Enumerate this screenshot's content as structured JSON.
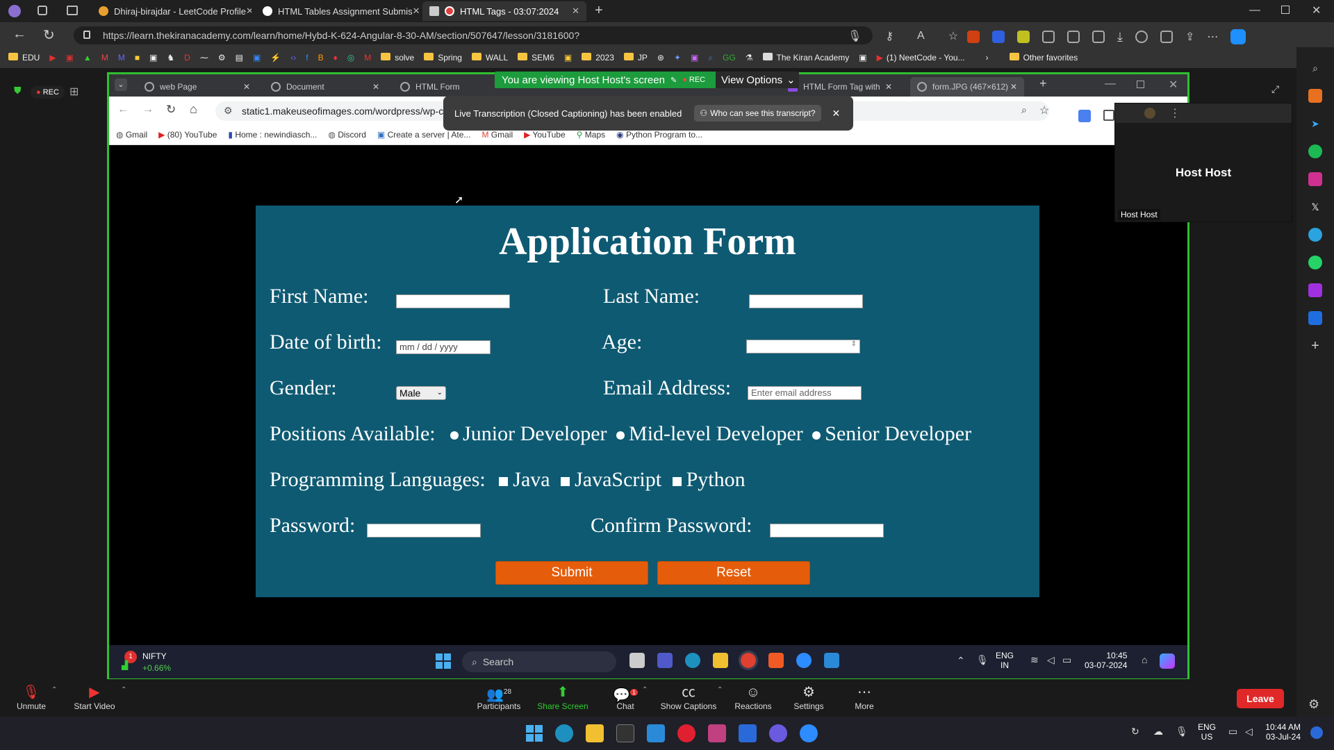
{
  "outer_browser": {
    "tabs": [
      {
        "title": "Dhiraj-birajdar - LeetCode Profile"
      },
      {
        "title": "HTML Tables Assignment Submis"
      },
      {
        "title": "HTML Tags - 03:07:2024",
        "active": true
      }
    ],
    "url": "https://learn.thekiranacademy.com/learn/home/Hybd-K-624-Angular-8-30-AM/section/507647/lesson/3181600?",
    "bookmarks": [
      "EDU",
      "solve",
      "Spring",
      "WALL",
      "SEM6",
      "2023",
      "JP",
      "The Kiran Academy",
      "(1) NeetCode - You...",
      "Other favorites"
    ]
  },
  "zoom": {
    "rec_label": "REC",
    "viewing_banner": "You are viewing Host Host's screen",
    "banner_rec": "REC",
    "view_options": "View Options",
    "transcription_msg": "Live Transcription (Closed Captioning) has been enabled",
    "who_can_see": "Who can see this transcript?",
    "host_name_big": "Host Host",
    "host_name_small": "Host Host",
    "controls": {
      "unmute": "Unmute",
      "start_video": "Start Video",
      "participants": "Participants",
      "participants_count": "28",
      "share_screen": "Share Screen",
      "chat": "Chat",
      "chat_badge": "1",
      "show_captions": "Show Captions",
      "reactions": "Reactions",
      "settings": "Settings",
      "more": "More",
      "leave": "Leave"
    }
  },
  "inner_browser": {
    "tabs": [
      {
        "title": "web Page"
      },
      {
        "title": "Document"
      },
      {
        "title": "HTML Form"
      },
      {
        "title": "HTML Form Tag with"
      },
      {
        "title": "form.JPG (467×612)"
      }
    ],
    "url": "static1.makeuseofimages.com/wordpress/wp-content/uploads/2021/06/application-form.jpeg",
    "bookmarks": [
      "Gmail",
      "(80) YouTube",
      "Home : newindiasch...",
      "Discord",
      "Create a server | Ate...",
      "Gmail",
      "YouTube",
      "Maps",
      "Python Program to..."
    ]
  },
  "form": {
    "title": "Application Form",
    "first_name_label": "First Name:",
    "last_name_label": "Last Name:",
    "dob_label": "Date of birth:",
    "dob_placeholder": "mm / dd / yyyy",
    "age_label": "Age:",
    "gender_label": "Gender:",
    "gender_value": "Male",
    "email_label": "Email Address:",
    "email_placeholder": "Enter email address",
    "positions_label": "Positions Available:",
    "positions": [
      "Junior Developer",
      "Mid-level Developer",
      "Senior Developer"
    ],
    "languages_label": "Programming Languages:",
    "languages": [
      "Java",
      "JavaScript",
      "Python"
    ],
    "password_label": "Password:",
    "confirm_password_label": "Confirm Password:",
    "submit": "Submit",
    "reset": "Reset"
  },
  "shared_taskbar": {
    "nifty_label": "NIFTY",
    "nifty_change": "+0.66%",
    "nifty_badge": "1",
    "search": "Search",
    "lang": "ENG",
    "region": "IN",
    "time": "10:45",
    "date": "03-07-2024"
  },
  "host_taskbar": {
    "lang": "ENG",
    "region": "US",
    "time": "10:44 AM",
    "date": "03-Jul-24"
  }
}
